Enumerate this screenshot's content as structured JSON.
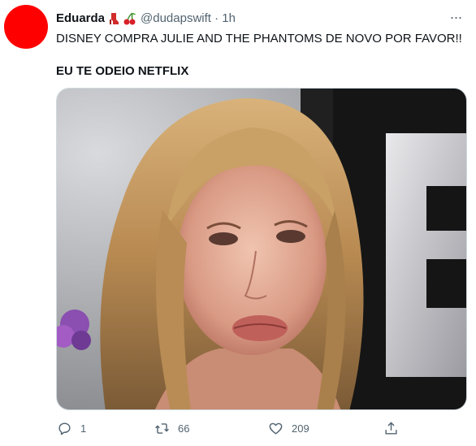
{
  "tweet": {
    "author_name": "Eduarda",
    "handle_time": "@dudapswift · 1h",
    "more_glyph": "···",
    "text_line1": "DISNEY COMPRA JULIE AND THE PHANTOMS DE NOVO POR FAVOR!!",
    "text_line2": "EU TE ODEIO NETFLIX",
    "avatar_color": "#ff0000",
    "emoji_names": [
      "high-heel-boot-icon",
      "cherries-icon"
    ],
    "media_description_icon": "photo-crying-woman"
  },
  "actions": {
    "reply_count": "1",
    "retweet_count": "66",
    "like_count": "209",
    "icons": [
      "reply-icon",
      "retweet-icon",
      "like-icon",
      "share-icon"
    ]
  },
  "colors": {
    "text": "#0f1419",
    "muted": "#536471",
    "border": "#cfd9de"
  }
}
